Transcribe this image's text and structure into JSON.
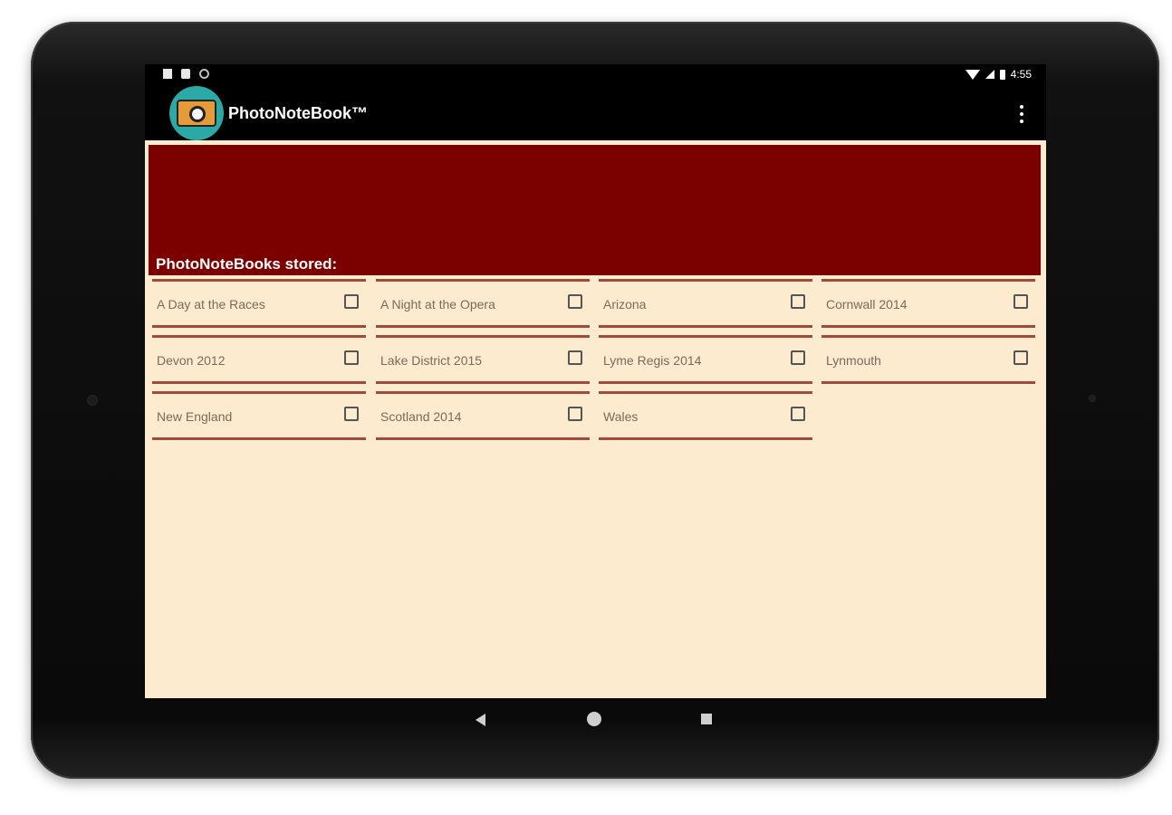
{
  "app_bar": {
    "title": "PhotoNoteBook™",
    "logo_icon": "camera-logo-icon",
    "menu_icon": "overflow-menu-icon"
  },
  "status_bar": {
    "time": "4:55"
  },
  "banner": {
    "label": "PhotoNoteBooks stored:",
    "color": "#7b0000"
  },
  "colors": {
    "background": "#fdebd0",
    "divider": "#a04a3d"
  },
  "notebooks": [
    {
      "label": "A Day at the Races",
      "checked": false
    },
    {
      "label": "A Night at the Opera",
      "checked": false
    },
    {
      "label": "Arizona",
      "checked": false
    },
    {
      "label": "Cornwall 2014",
      "checked": false
    },
    {
      "label": "Devon 2012",
      "checked": false
    },
    {
      "label": "Lake District 2015",
      "checked": false
    },
    {
      "label": "Lyme Regis 2014",
      "checked": false
    },
    {
      "label": "Lynmouth",
      "checked": false
    },
    {
      "label": "New England",
      "checked": false
    },
    {
      "label": "Scotland 2014",
      "checked": false
    },
    {
      "label": "Wales",
      "checked": false
    }
  ]
}
